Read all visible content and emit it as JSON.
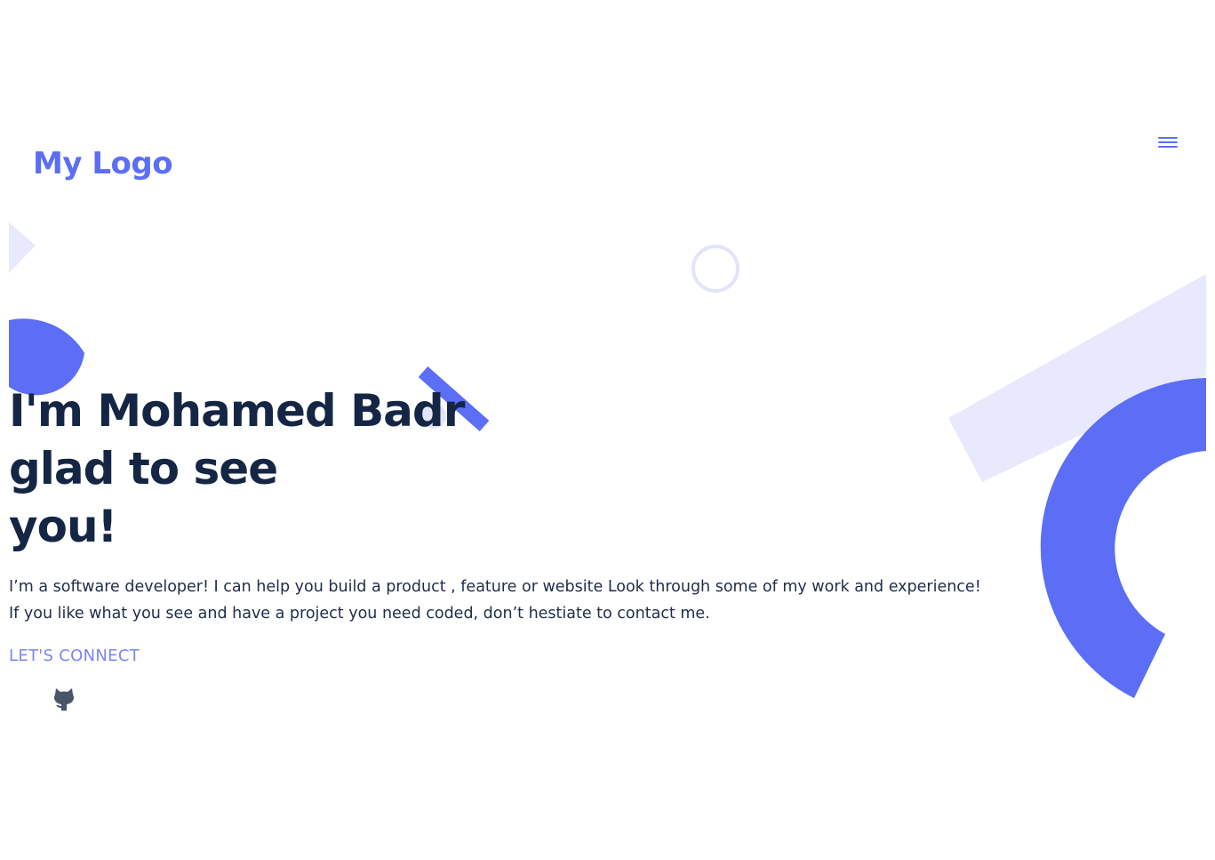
{
  "header": {
    "logo": "My Logo",
    "menu_icon": "hamburger-menu-icon"
  },
  "hero": {
    "title_lines": [
      "I'm Mohamed Badr",
      "glad to see",
      "you!"
    ],
    "description_lines": [
      "I’m a software developer! I can help you build a product , feature or website Look through some of my work and experience!",
      "If you like what you see and have a project you need coded, don’t hestiate to contact me."
    ],
    "cta_label": "LET'S CONNECT",
    "social_icon": "github-icon"
  },
  "colors": {
    "accent": "#5b6ef5",
    "accent_light": "#e8e9fd",
    "heading": "#152645",
    "body_text": "#1f2d4a",
    "link": "#7b86ef",
    "icon": "#4a5568"
  }
}
